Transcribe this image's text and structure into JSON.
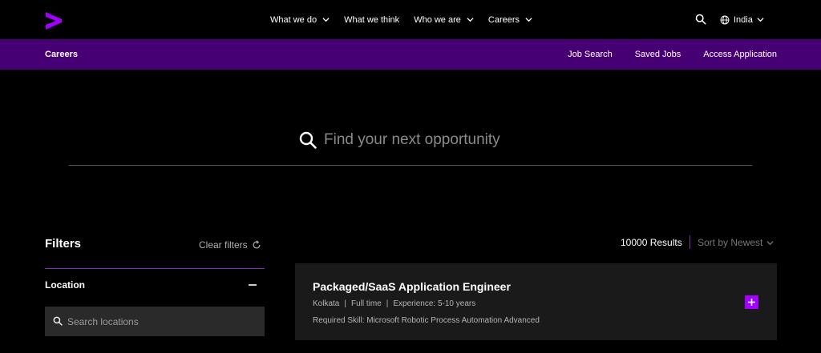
{
  "brand": {
    "accent": "#a100ff",
    "subnav_bg": "#460073",
    "logo_icon": "accenture-chevron-logo"
  },
  "topnav": {
    "items": [
      {
        "label": "What we do",
        "has_chevron": true
      },
      {
        "label": "What we think",
        "has_chevron": false
      },
      {
        "label": "Who we are",
        "has_chevron": true
      },
      {
        "label": "Careers",
        "has_chevron": true
      }
    ],
    "search_icon": "search-icon",
    "region": {
      "label": "India",
      "icon": "globe-icon"
    }
  },
  "subnav": {
    "title": "Careers",
    "links": [
      "Job Search",
      "Saved Jobs",
      "Access Application"
    ]
  },
  "hero": {
    "search_placeholder": "Find your next opportunity"
  },
  "filters": {
    "title": "Filters",
    "clear_label": "Clear filters",
    "location": {
      "label": "Location",
      "search_placeholder": "Search locations"
    }
  },
  "results": {
    "count_label": "10000 Results",
    "sort_label": "Sort by Newest"
  },
  "jobs": [
    {
      "title": "Packaged/SaaS Application Engineer",
      "location": "Kolkata",
      "type": "Full time",
      "experience": "Experience: 5-10 years",
      "skill": "Required Skill: Microsoft Robotic Process Automation Advanced"
    }
  ]
}
